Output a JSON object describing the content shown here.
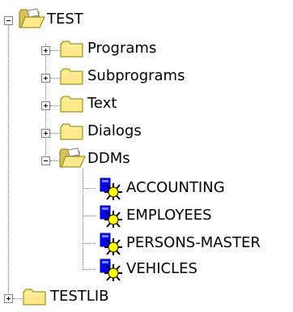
{
  "tree": {
    "root": {
      "label": "TEST",
      "icon": "folder-open-icon",
      "expanded": true,
      "children": [
        {
          "label": "Programs",
          "icon": "folder-closed-icon",
          "expanded": false
        },
        {
          "label": "Subprograms",
          "icon": "folder-closed-icon",
          "expanded": false
        },
        {
          "label": "Text",
          "icon": "folder-closed-icon",
          "expanded": false
        },
        {
          "label": "Dialogs",
          "icon": "folder-closed-icon",
          "expanded": false
        },
        {
          "label": "DDMs",
          "icon": "folder-open-icon",
          "expanded": true,
          "children": [
            {
              "label": "ACCOUNTING",
              "icon": "ddm-icon"
            },
            {
              "label": "EMPLOYEES",
              "icon": "ddm-icon"
            },
            {
              "label": "PERSONS-MASTER",
              "icon": "ddm-icon"
            },
            {
              "label": "VEHICLES",
              "icon": "ddm-icon"
            }
          ]
        }
      ]
    },
    "sibling": {
      "label": "TESTLIB",
      "icon": "folder-closed-icon",
      "expanded": false
    }
  },
  "colors": {
    "folder_fill": "#ffe98c",
    "folder_edge": "#808000",
    "ddm_blue": "#0000ff",
    "ddm_yellow": "#ffff00",
    "tree_line": "#808080"
  }
}
